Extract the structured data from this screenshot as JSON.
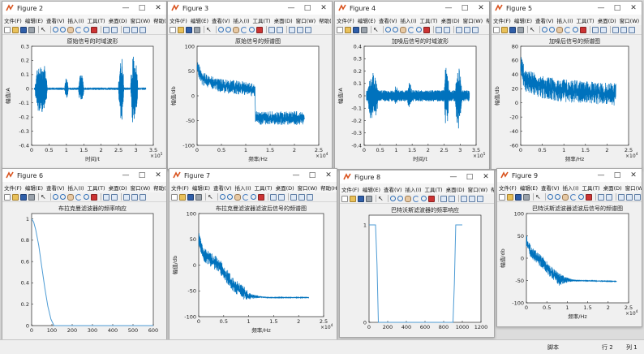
{
  "menu": [
    "文件(F)",
    "编辑(E)",
    "查看(V)",
    "插入(I)",
    "工具(T)",
    "桌面(D)",
    "窗口(W)",
    "帮助(H)"
  ],
  "colors": {
    "line": "#0072bd",
    "linelight": "#4d9bd4",
    "axes_bg": "#ffffff",
    "fig_bg": "#f0f0f0"
  },
  "figures": [
    {
      "id": "fig2",
      "title": "Figure 2",
      "plot_title": "原始信号的时域波形",
      "xlabel": "时间/t",
      "ylabel": "幅值/A",
      "xexp": "×10",
      "xexp_sup": "5",
      "chart_data": {
        "type": "line",
        "signal": "speech_waveform",
        "xlim": [
          0,
          3.5
        ],
        "ylim": [
          -0.4,
          0.3
        ],
        "xticks": [
          "0",
          "0.5",
          "1",
          "1.5",
          "2",
          "2.5",
          "3",
          "3.5"
        ],
        "yticks": [
          "0.3",
          "0.2",
          "0.1",
          "0",
          "-0.1",
          "-0.2",
          "-0.3",
          "-0.4"
        ],
        "bursts": [
          {
            "x": [
              0.1,
              0.45
            ],
            "amp": 0.22
          },
          {
            "x": [
              0.95,
              1.05
            ],
            "amp": 0.1
          },
          {
            "x": [
              1.35,
              1.5
            ],
            "amp": 0.12
          },
          {
            "x": [
              2.5,
              2.65
            ],
            "amp": 0.28
          },
          {
            "x": [
              2.85,
              3.05
            ],
            "amp": 0.3
          }
        ],
        "noise": 0.002
      }
    },
    {
      "id": "fig3",
      "title": "Figure 3",
      "plot_title": "原始信号的频谱图",
      "xlabel": "频率/Hz",
      "ylabel": "幅值/db",
      "xexp": "×10",
      "xexp_sup": "4",
      "chart_data": {
        "type": "line",
        "signal": "spectrum",
        "xlim": [
          0,
          2.5
        ],
        "ylim": [
          -100,
          100
        ],
        "xticks": [
          "0",
          "0.5",
          "1",
          "1.5",
          "2",
          "2.5"
        ],
        "yticks": [
          "100",
          "50",
          "0",
          "-50",
          "-100"
        ],
        "xmax": 2.205,
        "envelope": [
          [
            0,
            60
          ],
          [
            0.1,
            35
          ],
          [
            0.5,
            20
          ],
          [
            1.0,
            15
          ],
          [
            1.19,
            10
          ],
          [
            1.2,
            -45
          ],
          [
            2.2,
            -45
          ]
        ],
        "spread": 14
      }
    },
    {
      "id": "fig4",
      "title": "Figure 4",
      "plot_title": "加噪后信号的时域波形",
      "xlabel": "时间/t",
      "ylabel": "幅值/A",
      "xexp": "×10",
      "xexp_sup": "5",
      "chart_data": {
        "type": "line",
        "signal": "speech_waveform",
        "xlim": [
          0,
          3.5
        ],
        "ylim": [
          -0.4,
          0.4
        ],
        "xticks": [
          "0",
          "0.5",
          "1",
          "1.5",
          "2",
          "2.5",
          "3",
          "3.5"
        ],
        "yticks": [
          "0.4",
          "0.3",
          "0.2",
          "0.1",
          "0",
          "-0.1",
          "-0.2",
          "-0.3",
          "-0.4"
        ],
        "bursts": [
          {
            "x": [
              0.1,
              0.45
            ],
            "amp": 0.22
          },
          {
            "x": [
              0.95,
              1.05
            ],
            "amp": 0.1
          },
          {
            "x": [
              1.35,
              1.5
            ],
            "amp": 0.12
          },
          {
            "x": [
              2.5,
              2.65
            ],
            "amp": 0.28
          },
          {
            "x": [
              2.85,
              3.05
            ],
            "amp": 0.3
          }
        ],
        "noise": 0.045
      }
    },
    {
      "id": "fig5",
      "title": "Figure 5",
      "plot_title": "加噪后信号的频谱图",
      "xlabel": "频率/Hz",
      "ylabel": "幅值/db",
      "xexp": "×10",
      "xexp_sup": "4",
      "chart_data": {
        "type": "line",
        "signal": "spectrum",
        "xlim": [
          0,
          2.5
        ],
        "ylim": [
          -60,
          80
        ],
        "xticks": [
          "0",
          "0.5",
          "1",
          "1.5",
          "2",
          "2.5"
        ],
        "yticks": [
          "80",
          "60",
          "40",
          "20",
          "0",
          "-20",
          "-40",
          "-60"
        ],
        "xmax": 2.205,
        "envelope": [
          [
            0,
            55
          ],
          [
            0.1,
            32
          ],
          [
            0.5,
            22
          ],
          [
            1.0,
            17
          ],
          [
            2.2,
            12
          ]
        ],
        "spread": 16
      }
    },
    {
      "id": "fig6",
      "title": "Figure 6",
      "plot_title": "布拉克曼滤波器的频率响应",
      "xlabel": "",
      "ylabel": "",
      "xexp": "",
      "xexp_sup": "",
      "chart_data": {
        "type": "line",
        "signal": "lowpass_response",
        "xlim": [
          0,
          600
        ],
        "ylim": [
          0,
          1.05
        ],
        "xticks": [
          "0",
          "100",
          "200",
          "300",
          "400",
          "500",
          "600"
        ],
        "yticks": [
          "1",
          "0.8",
          "0.6",
          "0.4",
          "0.2",
          "0"
        ],
        "points": [
          [
            0,
            1.0
          ],
          [
            10,
            0.97
          ],
          [
            20,
            0.9
          ],
          [
            35,
            0.75
          ],
          [
            50,
            0.55
          ],
          [
            65,
            0.35
          ],
          [
            80,
            0.18
          ],
          [
            95,
            0.06
          ],
          [
            110,
            0.0
          ],
          [
            600,
            0.0
          ]
        ]
      }
    },
    {
      "id": "fig7",
      "title": "Figure 7",
      "plot_title": "布拉克曼滤波器滤波后信号的频谱图",
      "xlabel": "频率/Hz",
      "ylabel": "幅值/db",
      "xexp": "×10",
      "xexp_sup": "4",
      "chart_data": {
        "type": "line",
        "signal": "spectrum",
        "xlim": [
          0,
          2.5
        ],
        "ylim": [
          -100,
          100
        ],
        "xticks": [
          "0",
          "0.5",
          "1",
          "1.5",
          "2",
          "2.5"
        ],
        "yticks": [
          "100",
          "50",
          "0",
          "-50",
          "-100"
        ],
        "xmax": 2.205,
        "envelope": [
          [
            0,
            50
          ],
          [
            0.1,
            20
          ],
          [
            0.4,
            0
          ],
          [
            0.7,
            -40
          ],
          [
            1.0,
            -60
          ],
          [
            1.4,
            -63
          ],
          [
            2.2,
            -63
          ]
        ],
        "spread": 14,
        "taper_from": 0.9
      }
    },
    {
      "id": "fig8",
      "title": "Figure 8",
      "plot_title": "巴特沃斯滤波器的频率响应",
      "xlabel": "",
      "ylabel": "",
      "xexp": "",
      "xexp_sup": "",
      "chart_data": {
        "type": "line",
        "signal": "bandstop_response",
        "xlim": [
          0,
          1200
        ],
        "ylim": [
          0,
          1.1
        ],
        "xticks": [
          "0",
          "200",
          "400",
          "600",
          "800",
          "1000",
          "1200"
        ],
        "yticks": [
          "1",
          "0"
        ],
        "points": [
          [
            0,
            1.0
          ],
          [
            70,
            1.0
          ],
          [
            85,
            0.6
          ],
          [
            100,
            0.0
          ],
          [
            900,
            0.0
          ],
          [
            915,
            0.4
          ],
          [
            930,
            1.0
          ],
          [
            1000,
            1.0
          ]
        ]
      }
    },
    {
      "id": "fig9",
      "title": "Figure 9",
      "plot_title": "巴特沃斯滤波器滤波后信号的频谱图",
      "xlabel": "频率/Hz",
      "ylabel": "幅值/db",
      "xexp": "×10",
      "xexp_sup": "4",
      "chart_data": {
        "type": "line",
        "signal": "spectrum",
        "xlim": [
          0,
          2.5
        ],
        "ylim": [
          -100,
          100
        ],
        "xticks": [
          "0",
          "0.5",
          "1",
          "1.5",
          "2",
          "2.5"
        ],
        "yticks": [
          "100",
          "50",
          "0",
          "-50",
          "-100"
        ],
        "xmax": 2.205,
        "envelope": [
          [
            0,
            40
          ],
          [
            0.1,
            15
          ],
          [
            0.4,
            -10
          ],
          [
            0.6,
            -30
          ],
          [
            0.8,
            -48
          ],
          [
            1.2,
            -50
          ],
          [
            2.2,
            -52
          ]
        ],
        "spread": 14,
        "taper_from": 0.85
      }
    }
  ],
  "status": {
    "left_text": "脚本",
    "row": "行 2",
    "col": "列 1"
  }
}
